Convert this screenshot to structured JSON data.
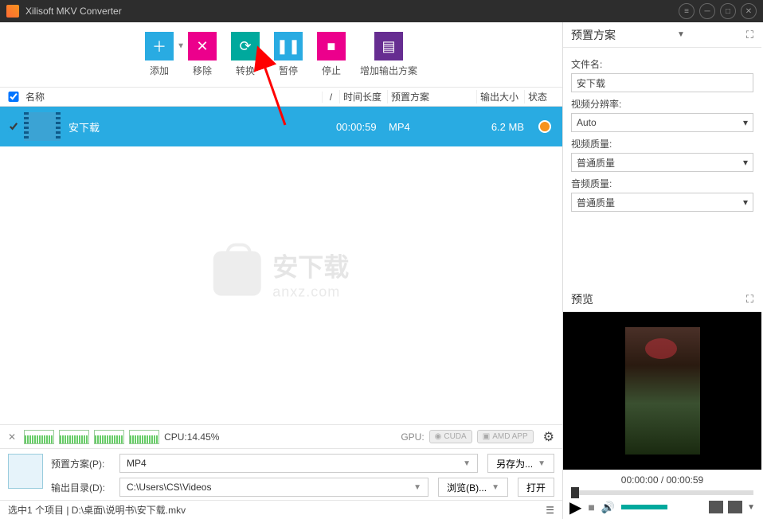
{
  "app": {
    "title": "Xilisoft MKV Converter"
  },
  "toolbar": {
    "add": "添加",
    "remove": "移除",
    "convert": "转换",
    "pause": "暂停",
    "stop": "停止",
    "add_profile": "增加输出方案"
  },
  "columns": {
    "name": "名称",
    "index": "/",
    "duration": "时间长度",
    "profile": "预置方案",
    "size": "输出大小",
    "status": "状态"
  },
  "items": [
    {
      "name": "安下载",
      "duration": "00:00:59",
      "profile": "MP4",
      "size": "6.2 MB"
    }
  ],
  "watermark": {
    "big": "安下载",
    "small": "anxz.com"
  },
  "perf": {
    "cpu_label": "CPU:14.45%",
    "gpu_label": "GPU:",
    "cuda": "CUDA",
    "amd": "AMD APP"
  },
  "bottom": {
    "profile_label": "预置方案(P):",
    "profile_value": "MP4",
    "saveas": "另存为...",
    "output_label": "输出目录(D):",
    "output_value": "C:\\Users\\CS\\Videos",
    "browse": "浏览(B)...",
    "open": "打开"
  },
  "status": {
    "text": "选中1 个项目 | D:\\桌面\\说明书\\安下载.mkv",
    "icon": "☰"
  },
  "preset": {
    "header": "预置方案",
    "filename_label": "文件名:",
    "filename_value": "安下载",
    "resolution_label": "视频分辨率:",
    "resolution_value": "Auto",
    "vquality_label": "视频质量:",
    "vquality_value": "普通质量",
    "aquality_label": "音频质量:",
    "aquality_value": "普通质量"
  },
  "preview": {
    "header": "预览",
    "time": "00:00:00 / 00:00:59"
  }
}
